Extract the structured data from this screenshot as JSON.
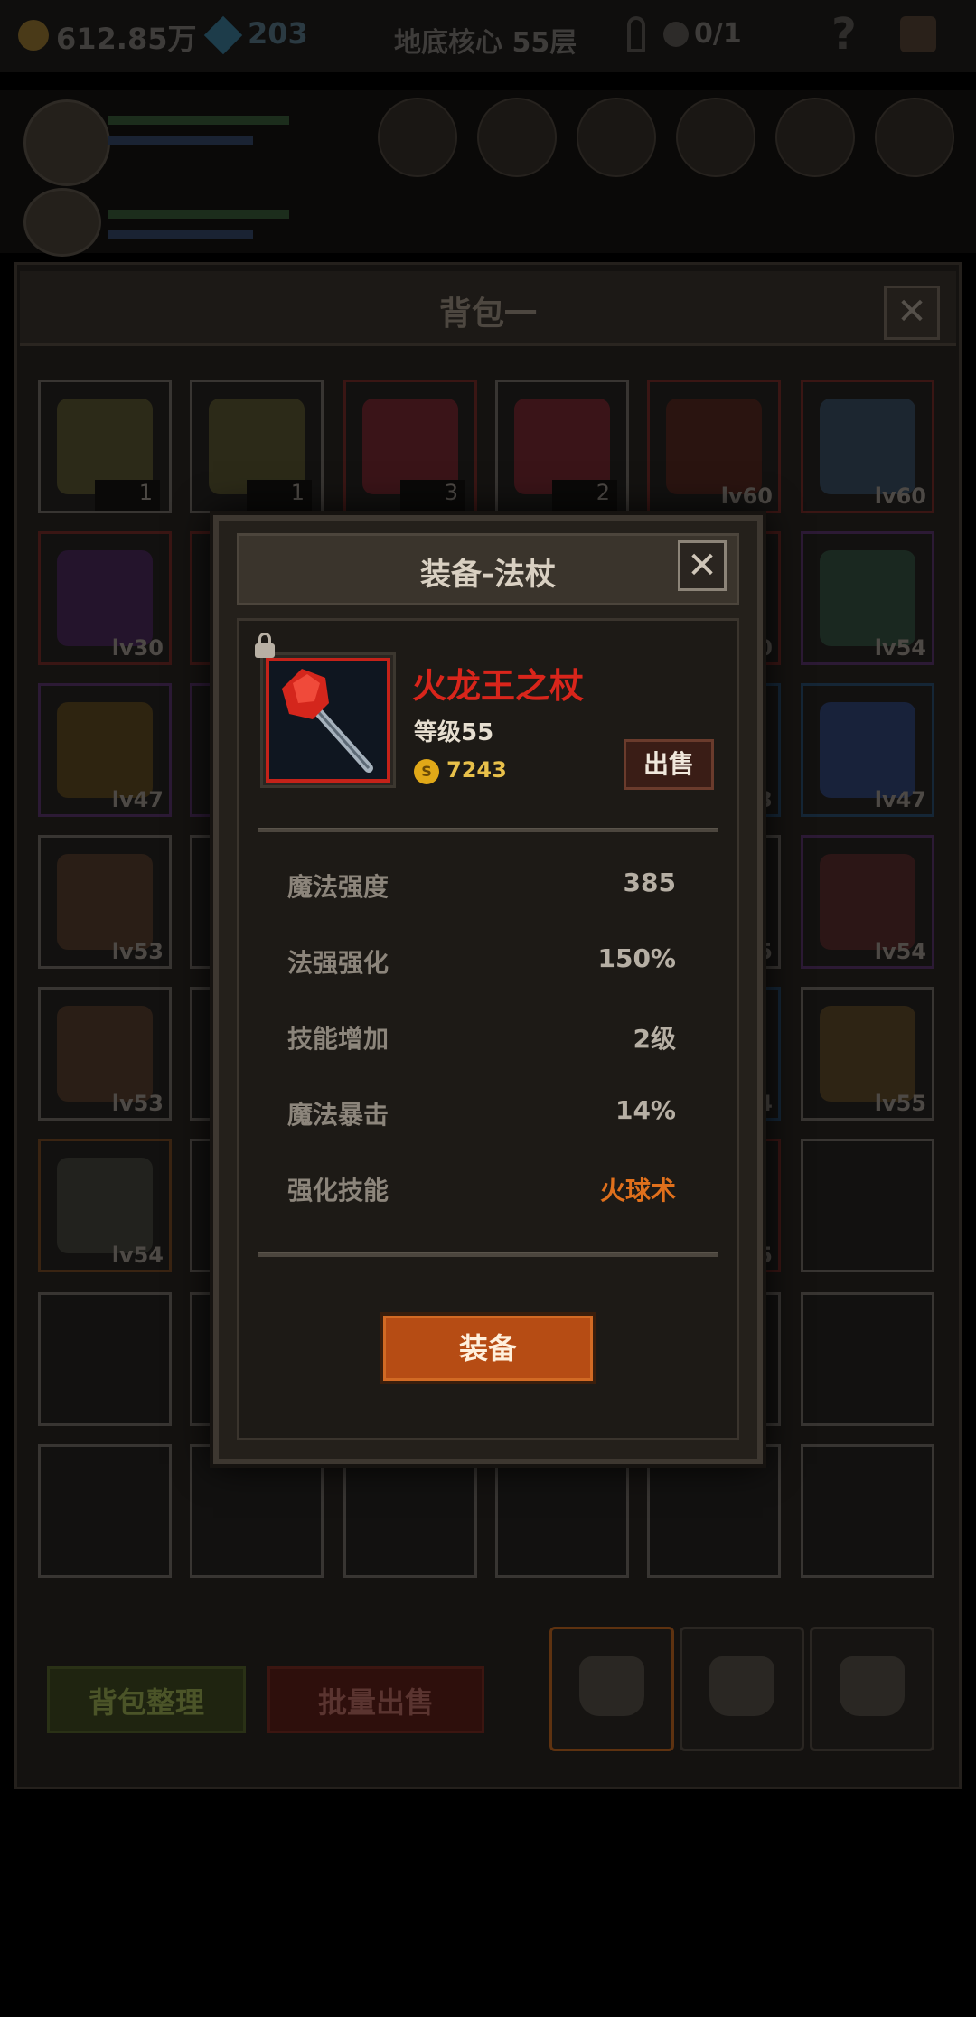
{
  "topbar": {
    "gold": "612.85万",
    "gems": "203",
    "location": "地底核心 55层",
    "keys": "0/1",
    "help": "?"
  },
  "bag": {
    "title": "背包一",
    "close": "✕",
    "slots": [
      {
        "label": "1",
        "kind": "qty",
        "rarity": "grey",
        "art": "beer-mug"
      },
      {
        "label": "1",
        "kind": "qty",
        "rarity": "grey",
        "art": "beer-mug"
      },
      {
        "label": "3",
        "kind": "qty",
        "rarity": "red",
        "art": "potion"
      },
      {
        "label": "2",
        "kind": "qty",
        "rarity": "grey",
        "art": "potion"
      },
      {
        "label": "lv60",
        "kind": "lv",
        "rarity": "red",
        "art": "trident"
      },
      {
        "label": "lv60",
        "kind": "lv",
        "rarity": "red",
        "art": "axe"
      },
      {
        "label": "lv30",
        "kind": "lv",
        "rarity": "red",
        "art": "claws"
      },
      {
        "label": "",
        "kind": "lv",
        "rarity": "red",
        "art": "hidden"
      },
      {
        "label": "",
        "kind": "lv",
        "rarity": "grey",
        "art": "hidden"
      },
      {
        "label": "",
        "kind": "lv",
        "rarity": "grey",
        "art": "hidden"
      },
      {
        "label": "0",
        "kind": "lv",
        "rarity": "red",
        "art": "hidden"
      },
      {
        "label": "lv54",
        "kind": "lv",
        "rarity": "purple",
        "art": "blade"
      },
      {
        "label": "lv47",
        "kind": "lv",
        "rarity": "purple",
        "art": "ring"
      },
      {
        "label": "",
        "kind": "lv",
        "rarity": "purple",
        "art": "hidden"
      },
      {
        "label": "",
        "kind": "lv",
        "rarity": "grey",
        "art": "hidden"
      },
      {
        "label": "",
        "kind": "lv",
        "rarity": "grey",
        "art": "hidden"
      },
      {
        "label": "3",
        "kind": "lv",
        "rarity": "blue",
        "art": "hidden"
      },
      {
        "label": "lv47",
        "kind": "lv",
        "rarity": "blue",
        "art": "amulet"
      },
      {
        "label": "lv53",
        "kind": "lv",
        "rarity": "grey",
        "art": "ring-blue"
      },
      {
        "label": "",
        "kind": "lv",
        "rarity": "grey",
        "art": "hidden"
      },
      {
        "label": "",
        "kind": "lv",
        "rarity": "grey",
        "art": "hidden"
      },
      {
        "label": "",
        "kind": "lv",
        "rarity": "grey",
        "art": "hidden"
      },
      {
        "label": "5",
        "kind": "lv",
        "rarity": "grey",
        "art": "hidden"
      },
      {
        "label": "lv54",
        "kind": "lv",
        "rarity": "purple",
        "art": "helmet"
      },
      {
        "label": "lv53",
        "kind": "lv",
        "rarity": "grey",
        "art": "ring-blue"
      },
      {
        "label": "",
        "kind": "lv",
        "rarity": "grey",
        "art": "hidden"
      },
      {
        "label": "",
        "kind": "lv",
        "rarity": "grey",
        "art": "hidden"
      },
      {
        "label": "",
        "kind": "lv",
        "rarity": "grey",
        "art": "hidden"
      },
      {
        "label": "4",
        "kind": "lv",
        "rarity": "blue",
        "art": "hidden"
      },
      {
        "label": "lv55",
        "kind": "lv",
        "rarity": "grey",
        "art": "book"
      },
      {
        "label": "lv54",
        "kind": "lv",
        "rarity": "orange",
        "art": "shoulder"
      },
      {
        "label": "",
        "kind": "lv",
        "rarity": "grey",
        "art": "hidden"
      },
      {
        "label": "",
        "kind": "lv",
        "rarity": "grey",
        "art": "hidden"
      },
      {
        "label": "",
        "kind": "lv",
        "rarity": "grey",
        "art": "hidden"
      },
      {
        "label": "5",
        "kind": "lv",
        "rarity": "red",
        "art": "hidden"
      },
      {
        "label": "",
        "kind": "empty",
        "rarity": "grey",
        "art": "none"
      },
      {
        "label": "",
        "kind": "empty",
        "rarity": "grey",
        "art": "none"
      },
      {
        "label": "",
        "kind": "empty",
        "rarity": "grey",
        "art": "none"
      },
      {
        "label": "",
        "kind": "empty",
        "rarity": "grey",
        "art": "none"
      },
      {
        "label": "",
        "kind": "empty",
        "rarity": "grey",
        "art": "none"
      },
      {
        "label": "",
        "kind": "empty",
        "rarity": "grey",
        "art": "none"
      },
      {
        "label": "",
        "kind": "empty",
        "rarity": "grey",
        "art": "none"
      },
      {
        "label": "",
        "kind": "empty",
        "rarity": "grey",
        "art": "none"
      },
      {
        "label": "",
        "kind": "empty",
        "rarity": "grey",
        "art": "none"
      },
      {
        "label": "",
        "kind": "empty",
        "rarity": "grey",
        "art": "none"
      },
      {
        "label": "",
        "kind": "empty",
        "rarity": "grey",
        "art": "none"
      },
      {
        "label": "",
        "kind": "empty",
        "rarity": "grey",
        "art": "none"
      },
      {
        "label": "",
        "kind": "empty",
        "rarity": "grey",
        "art": "none"
      }
    ],
    "sort_button": "背包整理",
    "bulk_sell_button": "批量出售"
  },
  "modal": {
    "title": "装备-法杖",
    "close": "✕",
    "item": {
      "name": "火龙王之杖",
      "level": "等级55",
      "price": "7243",
      "coin_glyph": "S",
      "sell_button": "出售"
    },
    "stats": [
      {
        "label": "魔法强度",
        "value": "385",
        "highlight": false
      },
      {
        "label": "法强强化",
        "value": "150%",
        "highlight": false
      },
      {
        "label": "技能增加",
        "value": "2级",
        "highlight": false
      },
      {
        "label": "魔法暴击",
        "value": "14%",
        "highlight": false
      },
      {
        "label": "强化技能",
        "value": "火球术",
        "highlight": true
      }
    ],
    "equip_button": "装备"
  },
  "colors": {
    "item_name": "#d9251b",
    "gold_text": "#e8c04a",
    "skill_highlight": "#e0701c",
    "equip_button": "#b64c14"
  }
}
